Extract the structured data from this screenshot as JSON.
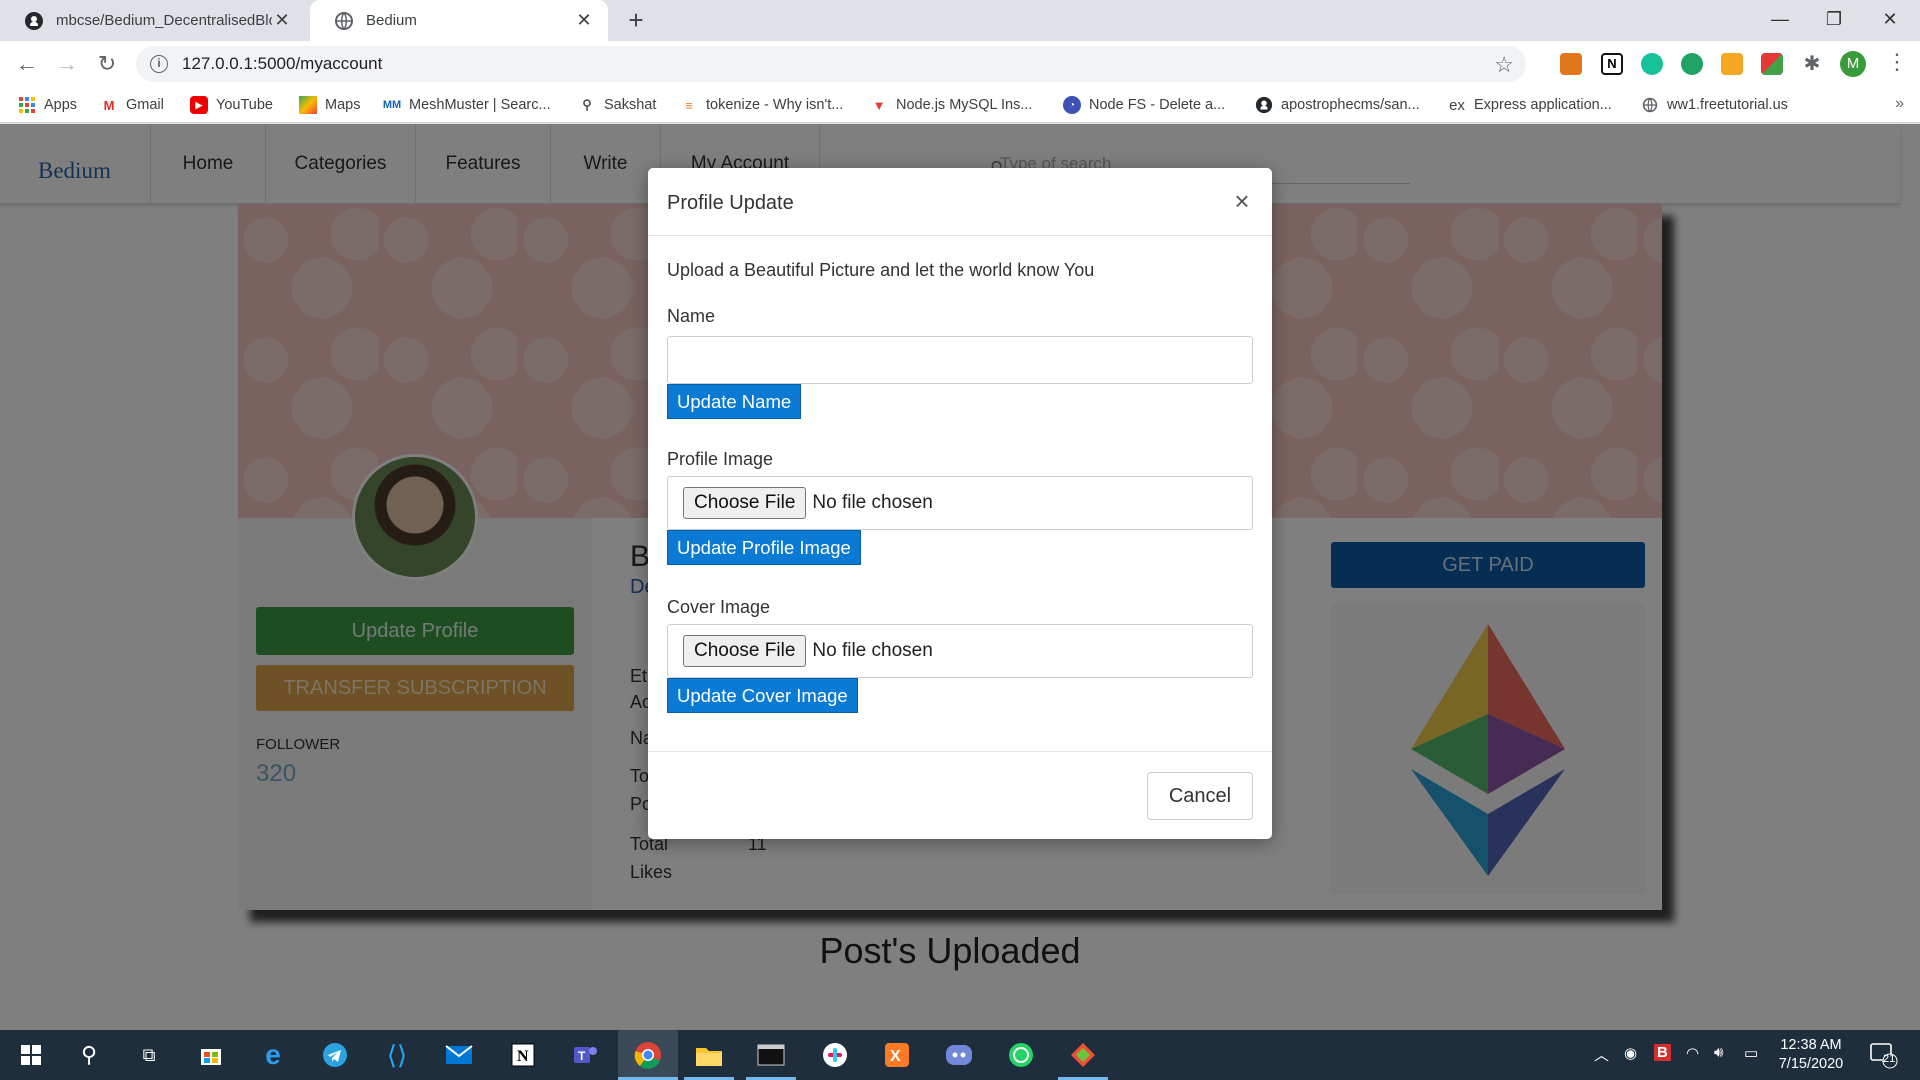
{
  "browser": {
    "tabs": [
      {
        "title": "mbcse/Bedium_DecentralisedBlo",
        "icon": "github-icon",
        "close": "✕"
      },
      {
        "title": "Bedium",
        "icon": "globe-icon",
        "close": "✕"
      }
    ],
    "new_tab": "+",
    "window": {
      "minimize": "—",
      "restore": "❐",
      "close": "✕"
    },
    "url": "127.0.0.1:5000/myaccount",
    "profile_initial": "M",
    "bookmarks": [
      {
        "label": "Apps",
        "icon": "apps-grid-icon"
      },
      {
        "label": "Gmail",
        "icon": "gmail-icon"
      },
      {
        "label": "YouTube",
        "icon": "youtube-icon"
      },
      {
        "label": "Maps",
        "icon": "maps-icon"
      },
      {
        "label": "MeshMuster | Searc...",
        "icon": "meshmuster-icon"
      },
      {
        "label": "Sakshat",
        "icon": "sakshat-icon"
      },
      {
        "label": "tokenize - Why isn't...",
        "icon": "stackoverflow-icon"
      },
      {
        "label": "Node.js MySQL Ins...",
        "icon": "w3schools-icon"
      },
      {
        "label": "Node FS - Delete a...",
        "icon": "node-icon"
      },
      {
        "label": "apostrophecms/san...",
        "icon": "github-icon"
      },
      {
        "label": "Express application...",
        "icon": "express-icon"
      },
      {
        "label": "ww1.freetutorial.us",
        "icon": "globe-icon"
      }
    ],
    "bookmarks_more": "»"
  },
  "site": {
    "brand": "Bedium",
    "nav": [
      "Home",
      "Categories",
      "Features",
      "Write",
      "My Account"
    ],
    "search_placeholder": "Type of search",
    "update_profile": "Update Profile",
    "transfer_subscription": "TRANSFER SUBSCRIPTION",
    "follower_label": "FOLLOWER",
    "follower_count": "320",
    "get_paid": "GET PAID",
    "peek": {
      "b": "B",
      "de": "De",
      "et": "Et",
      "ac": "Ac",
      "na": "Na",
      "to": "To",
      "po": "Po",
      "total": "Total",
      "likes": "Likes",
      "likes_value": "11"
    },
    "posts_heading": "Post's Uploaded"
  },
  "modal": {
    "title": "Profile Update",
    "close": "×",
    "intro": "Upload a Beautiful Picture and let the world know You",
    "name_label": "Name",
    "name_value": "",
    "update_name": "Update Name",
    "profile_image_label": "Profile Image",
    "choose_file": "Choose File",
    "no_file": "No file chosen",
    "update_profile_image": "Update Profile Image",
    "cover_image_label": "Cover Image",
    "update_cover_image": "Update Cover Image",
    "cancel": "Cancel"
  },
  "taskbar": {
    "time": "12:38 AM",
    "date": "7/15/2020",
    "notifications": "21"
  }
}
